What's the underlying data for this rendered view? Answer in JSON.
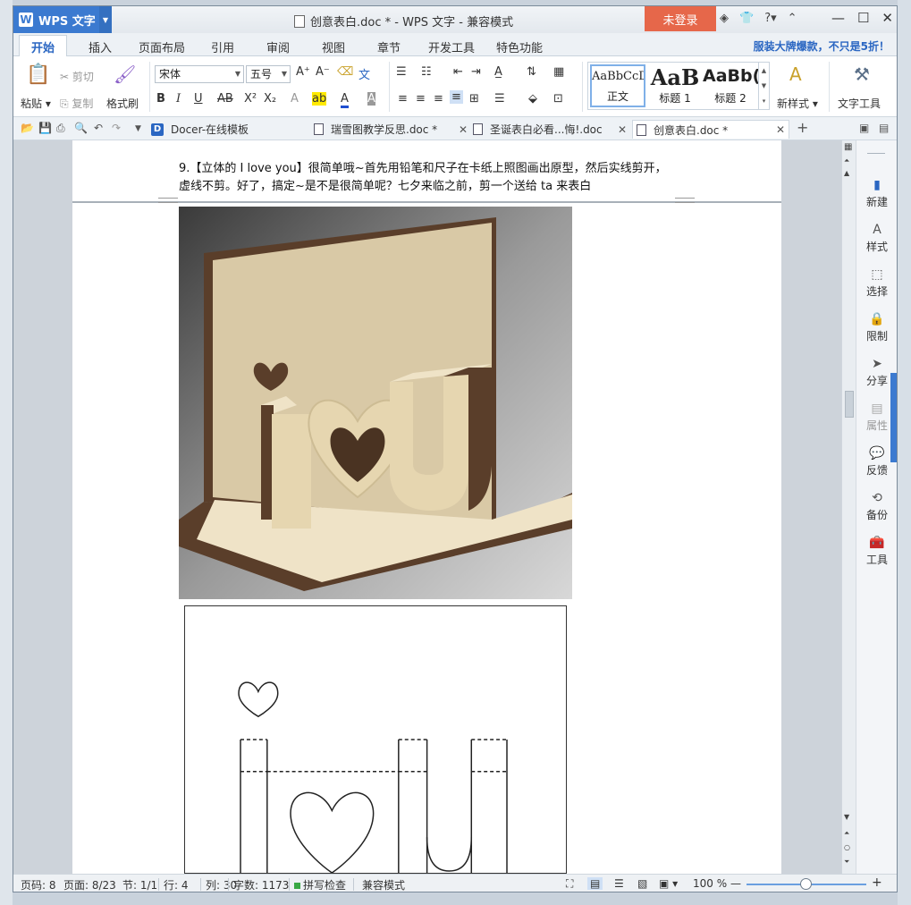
{
  "window": {
    "app_button": "WPS 文字",
    "title": "创意表白.doc * - WPS 文字 - 兼容模式",
    "login": "未登录",
    "help": "?"
  },
  "ribbon_tabs": [
    "开始",
    "插入",
    "页面布局",
    "引用",
    "审阅",
    "视图",
    "章节",
    "开发工具",
    "特色功能"
  ],
  "promo": "服装大牌爆款，不只是5折！",
  "ribbon": {
    "paste": "粘贴",
    "cut": "剪切",
    "copy": "复制",
    "format_painter": "格式刷",
    "font_name": "宋体",
    "font_size": "五号",
    "styles": [
      {
        "sample": "AaBbCcD",
        "name": "正文"
      },
      {
        "sample": "AaB",
        "name": "标题 1"
      },
      {
        "sample": "AaBb(",
        "name": "标题 2"
      }
    ],
    "new_style": "新样式",
    "text_tools": "文字工具"
  },
  "doc_tabs": [
    {
      "label": "Docer-在线模板"
    },
    {
      "label": "瑞雪图教学反思.doc *"
    },
    {
      "label": "圣诞表白必看...悔!.doc"
    },
    {
      "label": "创意表白.doc *"
    }
  ],
  "document": {
    "paragraph_line1": "9.【立体的 I love you】很简单哦~首先用铅笔和尺子在卡纸上照图画出原型，然后实线剪开，",
    "paragraph_line2": "虚线不剪。好了，搞定~是不是很简单呢？七夕来临之前，剪一个送给 ta 来表白"
  },
  "task_pane": [
    {
      "label": "新建",
      "icon": "new-doc-icon"
    },
    {
      "label": "样式",
      "icon": "style-icon"
    },
    {
      "label": "选择",
      "icon": "select-icon"
    },
    {
      "label": "限制",
      "icon": "lock-icon"
    },
    {
      "label": "分享",
      "icon": "share-icon"
    },
    {
      "label": "属性",
      "icon": "properties-icon"
    },
    {
      "label": "反馈",
      "icon": "feedback-icon"
    },
    {
      "label": "备份",
      "icon": "backup-icon"
    },
    {
      "label": "工具",
      "icon": "toolbox-icon"
    }
  ],
  "status": {
    "page_code": "页码: 8",
    "page": "页面: 8/23",
    "section": "节: 1/1",
    "row": "行: 4",
    "col": "列: 30",
    "word_count": "字数: 1173",
    "spell_check": "拼写检查",
    "compat_mode": "兼容模式",
    "zoom": "100 %"
  },
  "colors": {
    "accent": "#3b7ad0",
    "login": "#e6674a",
    "card_back": "#d9c9a6",
    "card_edge": "#5a3e2a"
  }
}
